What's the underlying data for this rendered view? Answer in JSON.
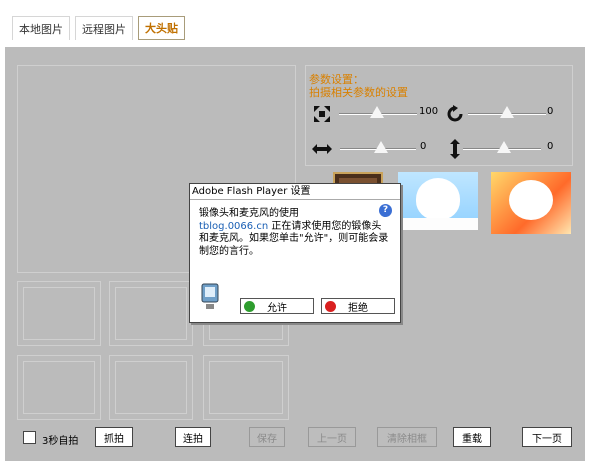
{
  "tabs": [
    {
      "label": "本地图片"
    },
    {
      "label": "远程图片"
    },
    {
      "label": "大头贴"
    }
  ],
  "params": {
    "title1": "参数设置：",
    "title2": "拍摄相关参数的设置",
    "zoom_value": "100",
    "rotate_value": "0",
    "hpos_value": "0",
    "vpos_value": "0"
  },
  "dialog": {
    "title": "Adobe Flash Player 设置",
    "line1": "锻像头和麦克风的使用",
    "site": "tblog.0066.cn",
    "line2": " 正在请求使用您的锻像头和麦克风。如果您单击\"允许\"，则可能会录制您的言行。",
    "allow": "允许",
    "deny": "拒绝"
  },
  "controls": {
    "timer_label": "3秒自拍",
    "capture": "抓拍",
    "burst": "连拍",
    "save": "保存",
    "prev": "上一页",
    "clear": "清除相框",
    "reload": "重载",
    "next": "下一页"
  }
}
